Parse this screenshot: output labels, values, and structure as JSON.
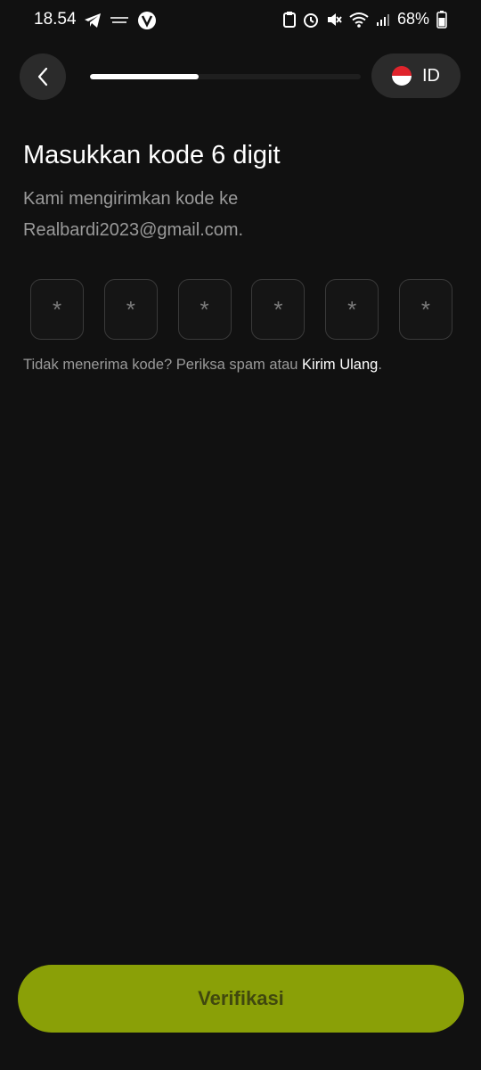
{
  "status_bar": {
    "time": "18.54",
    "battery_percent": "68%",
    "left_icons": [
      "telegram-icon",
      "notification-app-icon",
      "v-badge-icon"
    ],
    "right_icons": [
      "clipboard-icon",
      "alarm-icon",
      "mute-icon",
      "wifi-icon",
      "signal-icon",
      "battery-icon"
    ]
  },
  "header": {
    "progress": 0.4,
    "language_code": "ID"
  },
  "content": {
    "title": "Masukkan kode 6 digit",
    "subtitle": "Kami mengirimkan kode ke Realbardi2023@gmail.com.",
    "code_placeholders": [
      "*",
      "*",
      "*",
      "*",
      "*",
      "*"
    ],
    "resend_prefix": "Tidak menerima kode? Periksa spam atau ",
    "resend_link": "Kirim Ulang",
    "resend_suffix": "."
  },
  "footer": {
    "verify_label": "Verifikasi"
  },
  "colors": {
    "background": "#111111",
    "accent": "#8aa007",
    "button_text": "#40480e"
  }
}
